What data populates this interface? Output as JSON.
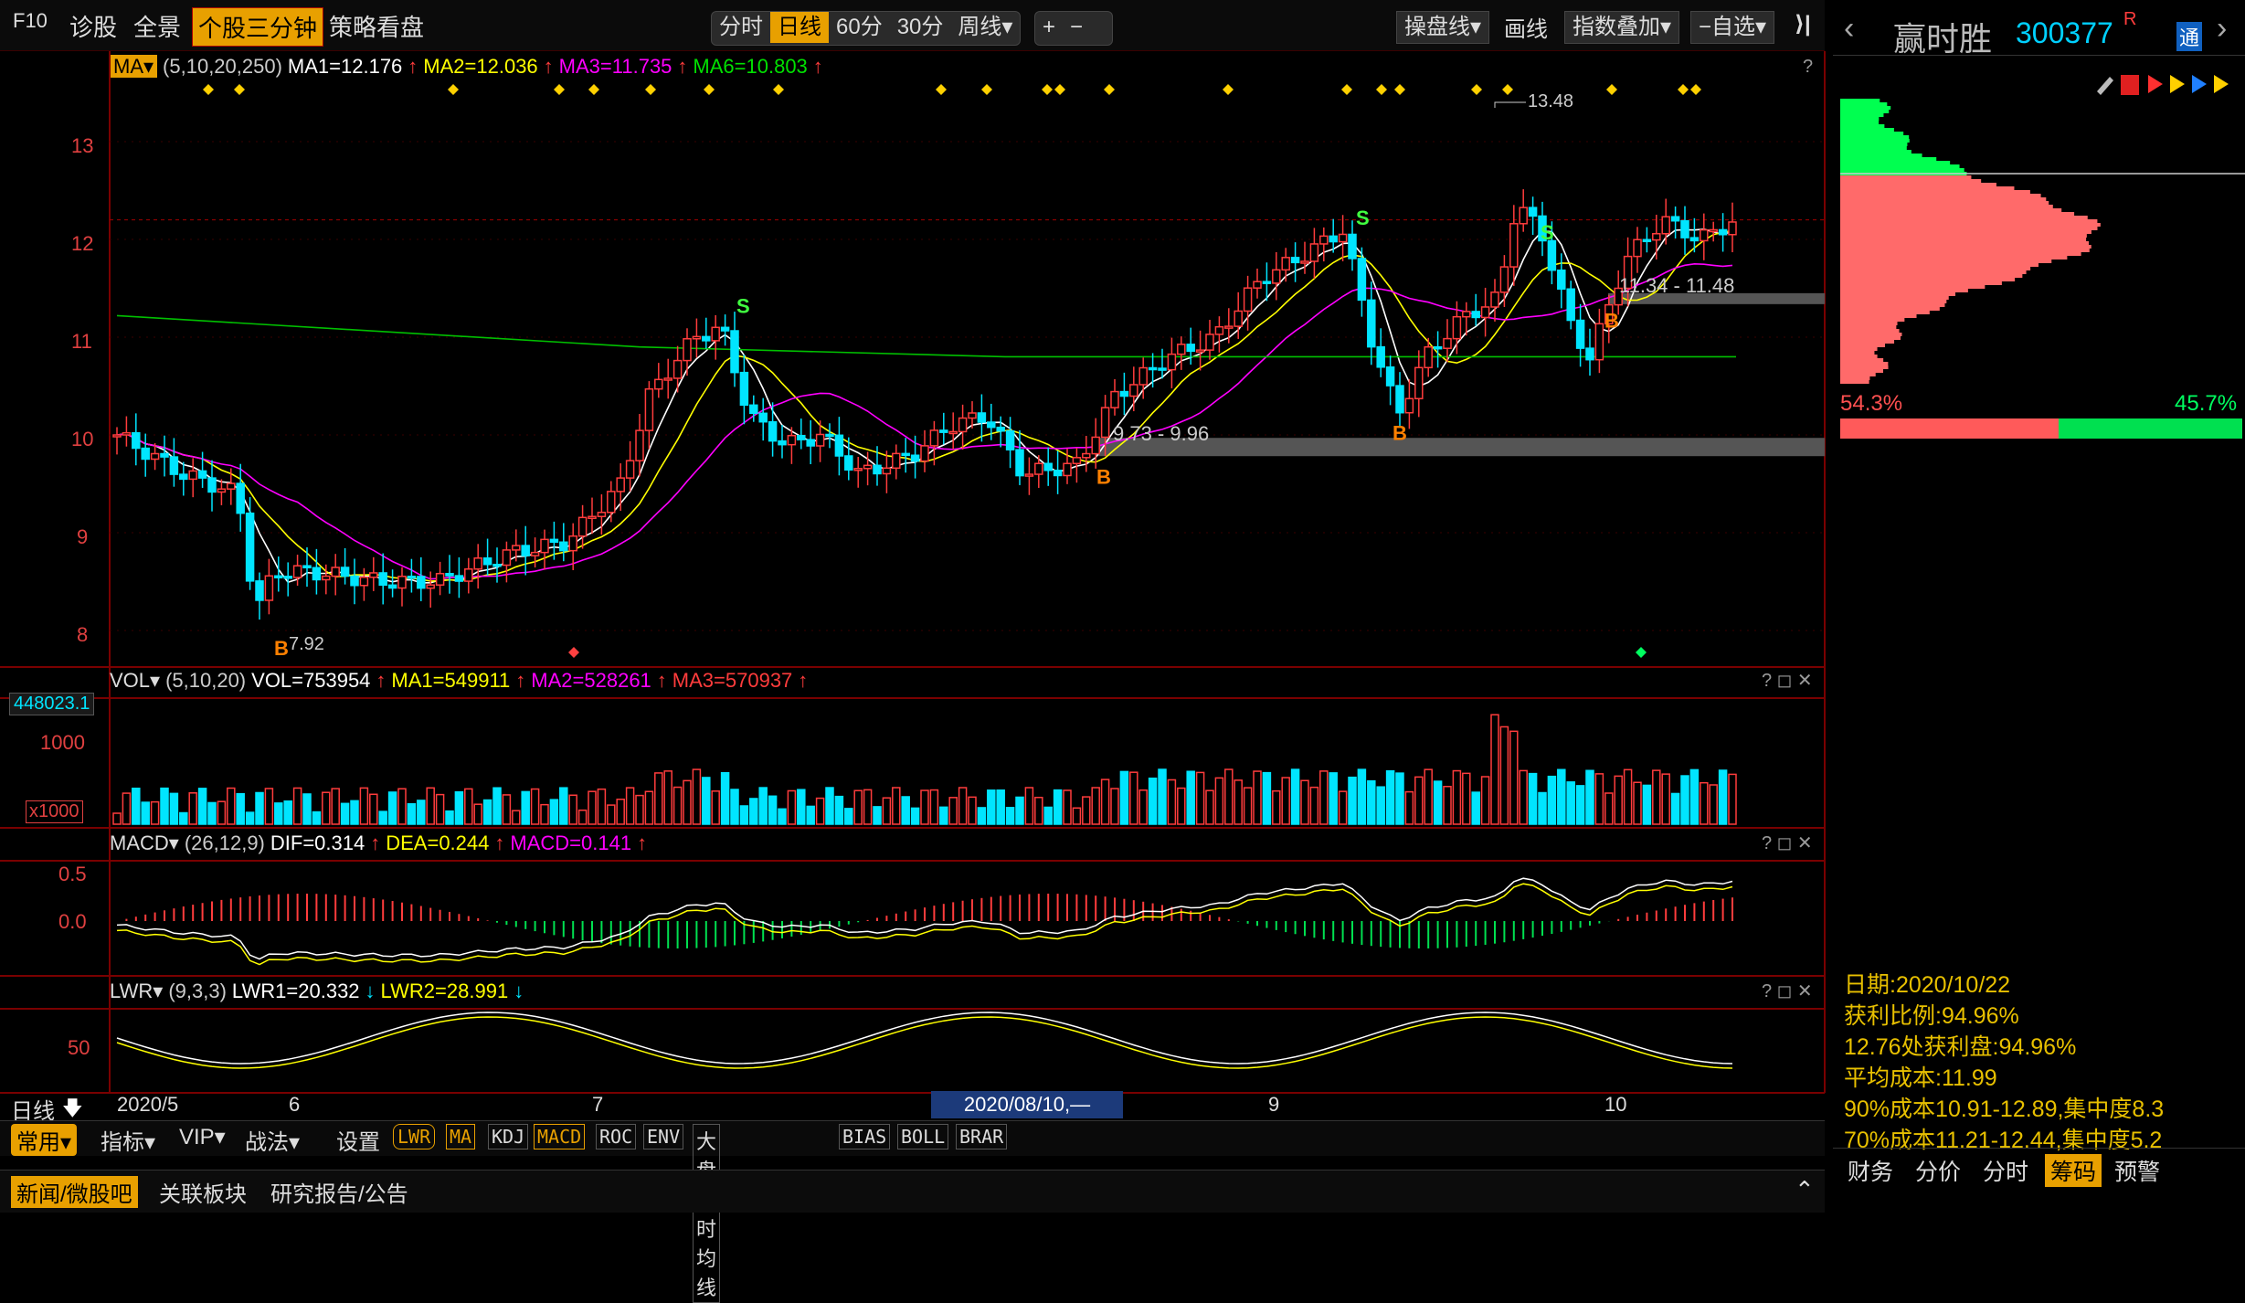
{
  "toolbar": {
    "f10": "F10",
    "diagnose": "诊股",
    "panorama": "全景",
    "three_min": "个股三分钟",
    "strategy": "策略看盘",
    "periods": [
      "分时",
      "日线",
      "60分",
      "30分",
      "周线▾"
    ],
    "active_period": "日线",
    "zoom_in": "+",
    "zoom_out": "−",
    "operate_line": "操盘线▾",
    "draw_line": "画线",
    "index_overlay": "指数叠加▾",
    "self_select": "−自选▾",
    "collapse": "⟩|"
  },
  "stock": {
    "name": "赢时胜",
    "code": "300377",
    "badge": "R",
    "tong": "通"
  },
  "ma_header": {
    "name": "MA▾",
    "params": "(5,10,20,250)",
    "ma1": "MA1=12.176",
    "ma2": "MA2=12.036",
    "ma3": "MA3=11.735",
    "ma6": "MA6=10.803",
    "up": "↑",
    "help": "?"
  },
  "vol_header": {
    "name": "VOL▾",
    "params": "(5,10,20)",
    "vol": "VOL=753954",
    "ma1": "MA1=549911",
    "ma2": "MA2=528261",
    "ma3": "MA3=570937",
    "up": "↑",
    "controls": "? ◻ ✕"
  },
  "macd_header": {
    "name": "MACD▾",
    "params": "(26,12,9)",
    "dif": "DIF=0.314",
    "dea": "DEA=0.244",
    "macd": "MACD=0.141",
    "up": "↑",
    "controls": "? ◻ ✕"
  },
  "lwr_header": {
    "name": "LWR▾",
    "params": "(9,3,3)",
    "lwr1": "LWR1=20.332",
    "lwr2": "LWR2=28.991",
    "down": "↓",
    "controls": "? ◻ ✕"
  },
  "price_axis": [
    "13",
    "12",
    "11",
    "10",
    "9",
    "8"
  ],
  "vol_axis": {
    "top": "448023.1",
    "mid": "1000",
    "unit": "x1000"
  },
  "macd_axis": [
    "0.5",
    "0.0"
  ],
  "lwr_axis": [
    "50"
  ],
  "annotations": {
    "high": "13.48",
    "low": "7.92",
    "range1": "9.73 - 9.96",
    "range2": "11.34 - 11.48",
    "buy": "B",
    "sell": "S"
  },
  "x_axis": {
    "left": "日线",
    "labels": [
      "2020/5",
      "6",
      "7",
      "8",
      "9",
      "10"
    ],
    "cursor": "2020/08/10,—"
  },
  "bottom_bar": {
    "tabs": [
      "常用▾",
      "指标▾",
      "VIP▾",
      "战法▾",
      "设置"
    ],
    "indicators": [
      "LWR",
      "MA",
      "KDJ",
      "MACD",
      "ROC",
      "ENV",
      "大盘分时均线",
      "BIAS",
      "BOLL",
      "BRAR"
    ]
  },
  "news_bar": {
    "tabs": [
      "新闻/微股吧",
      "关联板块",
      "研究报告/公告"
    ],
    "collapse": "⌃"
  },
  "chips": {
    "profit_pct": "54.3%",
    "loss_pct": "45.7%",
    "date": "日期:2020/10/22",
    "profit_ratio": "获利比例:94.96%",
    "profit_at": "12.76处获利盘:94.96%",
    "avg_cost": "平均成本:11.99",
    "cost90": "90%成本10.91-12.89,集中度8.3",
    "cost70": "70%成本11.21-12.44,集中度5.2",
    "tabs": [
      "财务",
      "分价",
      "分时",
      "筹码",
      "预警"
    ],
    "active_tab": "筹码"
  },
  "colors": {
    "up": "#ff3c3c",
    "down": "#00e5ff",
    "ma5": "#ffffff",
    "ma10": "#ffff00",
    "ma20": "#ff00ff",
    "ma250": "#00c000",
    "accent": "#e8a000"
  }
}
